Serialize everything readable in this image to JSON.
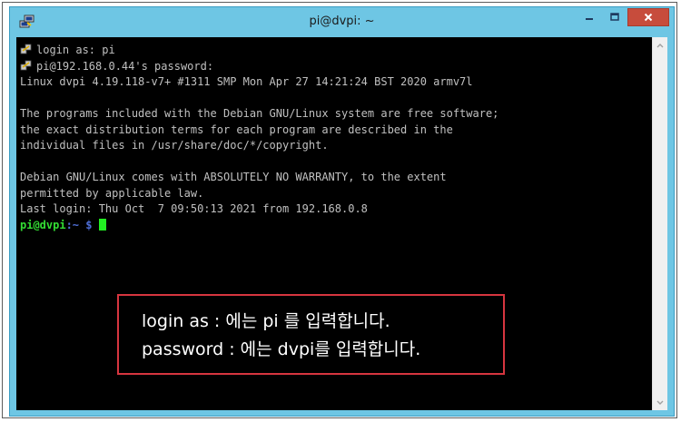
{
  "window": {
    "title": "pi@dvpi: ~"
  },
  "terminal": {
    "lines": [
      "login as: pi",
      "pi@192.168.0.44's password:",
      "Linux dvpi 4.19.118-v7+ #1311 SMP Mon Apr 27 14:21:24 BST 2020 armv7l",
      "",
      "The programs included with the Debian GNU/Linux system are free software;",
      "the exact distribution terms for each program are described in the",
      "individual files in /usr/share/doc/*/copyright.",
      "",
      "Debian GNU/Linux comes with ABSOLUTELY NO WARRANTY, to the extent",
      "permitted by applicable law.",
      "Last login: Thu Oct  7 09:50:13 2021 from 192.168.0.8"
    ],
    "prompt_user": "pi@dvpi",
    "prompt_path": ":~ $",
    "colors": {
      "background": "#000000",
      "text": "#c0c0c0",
      "prompt_user": "#33dd33",
      "prompt_path": "#4f6fd8",
      "cursor": "#22ee22"
    }
  },
  "annotation": {
    "line1": "login as : 에는 pi 를 입력합니다.",
    "line2": "password : 에는 dvpi를 입력합니다.",
    "border_color": "#d6353f"
  },
  "icons": {
    "app": "putty-icon",
    "key": "key-icon",
    "minimize": "minimize-icon",
    "maximize": "maximize-icon",
    "close": "close-icon",
    "scroll_up": "chevron-up-icon",
    "scroll_down": "chevron-down-icon"
  }
}
